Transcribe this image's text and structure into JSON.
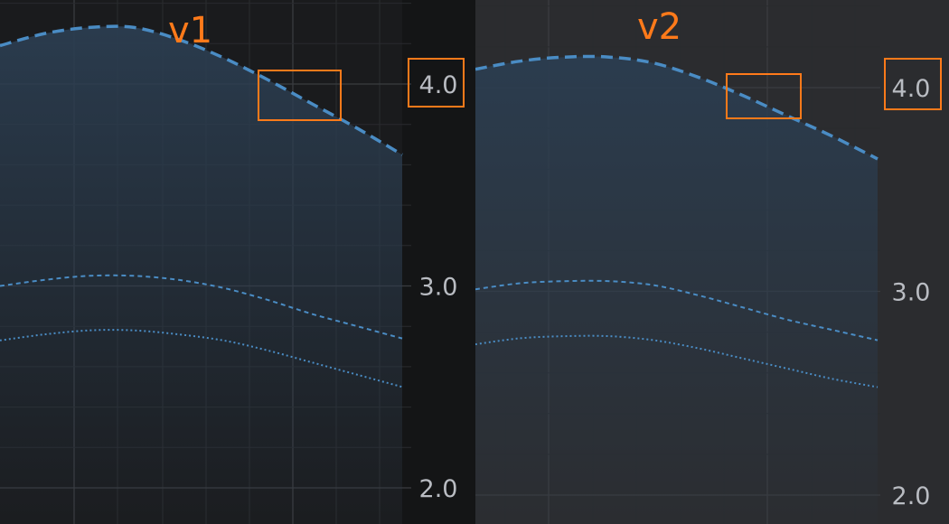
{
  "chart_data": [
    {
      "type": "line",
      "title": "v1",
      "ylim": [
        2.0,
        4.0
      ],
      "yticks": [
        "4.0",
        "3.0",
        "2.0"
      ],
      "highlighted_tick": "4.0",
      "grid": true,
      "x": [
        0,
        1,
        2,
        3,
        4,
        5,
        6,
        7,
        8,
        9
      ],
      "series": [
        {
          "values": [
            4.19,
            4.25,
            4.28,
            4.28,
            4.22,
            4.13,
            4.02,
            3.9,
            3.78,
            3.65
          ],
          "style": "dashed-thick",
          "fill": true
        },
        {
          "values": [
            3.0,
            3.03,
            3.05,
            3.05,
            3.03,
            2.99,
            2.93,
            2.86,
            2.8,
            2.74
          ],
          "style": "dashed-thin"
        },
        {
          "values": [
            2.73,
            2.76,
            2.78,
            2.78,
            2.76,
            2.73,
            2.68,
            2.62,
            2.56,
            2.5
          ],
          "style": "dotted"
        }
      ],
      "colors": {
        "line": "#4a8cc4",
        "fill": "#2b3d50",
        "highlight": "#ff7a1a"
      }
    },
    {
      "type": "line",
      "title": "v2",
      "ylim": [
        2.0,
        4.0
      ],
      "yticks": [
        "4.0",
        "3.0",
        "2.0"
      ],
      "highlighted_tick": "4.0",
      "grid": true,
      "x": [
        0,
        1,
        2,
        3,
        4,
        5,
        6,
        7,
        8,
        9
      ],
      "series": [
        {
          "values": [
            4.09,
            4.13,
            4.15,
            4.15,
            4.12,
            4.05,
            3.96,
            3.86,
            3.76,
            3.65
          ],
          "style": "dashed-thick",
          "fill": true
        },
        {
          "values": [
            3.01,
            3.04,
            3.05,
            3.05,
            3.03,
            2.98,
            2.92,
            2.86,
            2.81,
            2.76
          ],
          "style": "dashed-thin"
        },
        {
          "values": [
            2.74,
            2.77,
            2.78,
            2.78,
            2.76,
            2.72,
            2.67,
            2.62,
            2.57,
            2.53
          ],
          "style": "dotted"
        }
      ],
      "colors": {
        "line": "#4a8cc4",
        "fill": "#2b3d50",
        "highlight": "#ff7a1a"
      }
    }
  ]
}
